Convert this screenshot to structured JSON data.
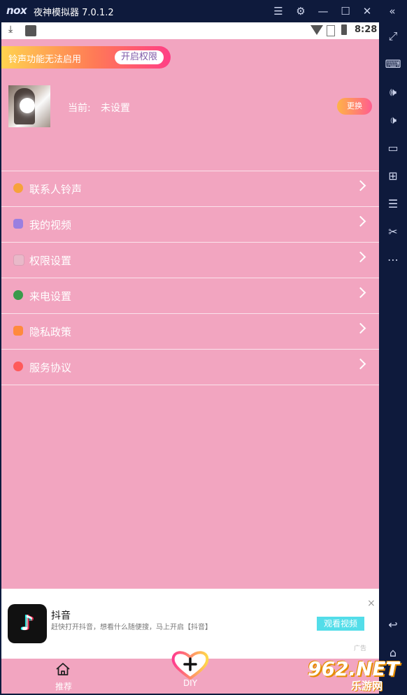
{
  "window": {
    "logo": "nox",
    "title": "夜神模拟器 7.0.1.2",
    "controls": [
      "menu-icon",
      "gear-icon",
      "minimize-icon",
      "maximize-icon",
      "close-icon",
      "collapse-icon"
    ]
  },
  "statusbar": {
    "time": "8:28",
    "icons": [
      "download-icon",
      "notification-square-icon",
      "wifi-icon",
      "no-signal-icon",
      "battery-icon"
    ]
  },
  "banner": {
    "text": "铃声功能无法启用",
    "button": "开启权限"
  },
  "current": {
    "label": "当前:",
    "value": "未设置",
    "change_button": "更换"
  },
  "menu": {
    "items": [
      {
        "label": "联系人铃声",
        "icon": "contact-ring-icon",
        "color": "#f7a23b"
      },
      {
        "label": "我的视频",
        "icon": "download-video-icon",
        "color": "#9a7fe0"
      },
      {
        "label": "权限设置",
        "icon": "lock-icon",
        "color": "#e9b9c9"
      },
      {
        "label": "来电设置",
        "icon": "clover-icon",
        "color": "#3a9a4a"
      },
      {
        "label": "隐私政策",
        "icon": "privacy-icon",
        "color": "#ff8a3d"
      },
      {
        "label": "服务协议",
        "icon": "agreement-icon",
        "color": "#ff5a5a"
      }
    ]
  },
  "ad": {
    "app_icon": "tiktok-icon",
    "title": "抖音",
    "description": "赶快打开抖音，想看什么随便搜，马上开启【抖音】",
    "button": "观看视频",
    "close": "×",
    "mark": "广告"
  },
  "bottomnav": {
    "home_label": "推荐",
    "diy_label": "DIY"
  },
  "sidebar": {
    "icons": [
      "fullscreen-icon",
      "keyboard-icon",
      "volume-up-icon",
      "volume-down-icon",
      "screen-icon",
      "apk-install-icon",
      "multi-instance-icon",
      "scissors-icon",
      "more-icon",
      "back-icon",
      "home-icon"
    ]
  },
  "watermark": {
    "big": "962.NET",
    "small": "乐游网"
  }
}
